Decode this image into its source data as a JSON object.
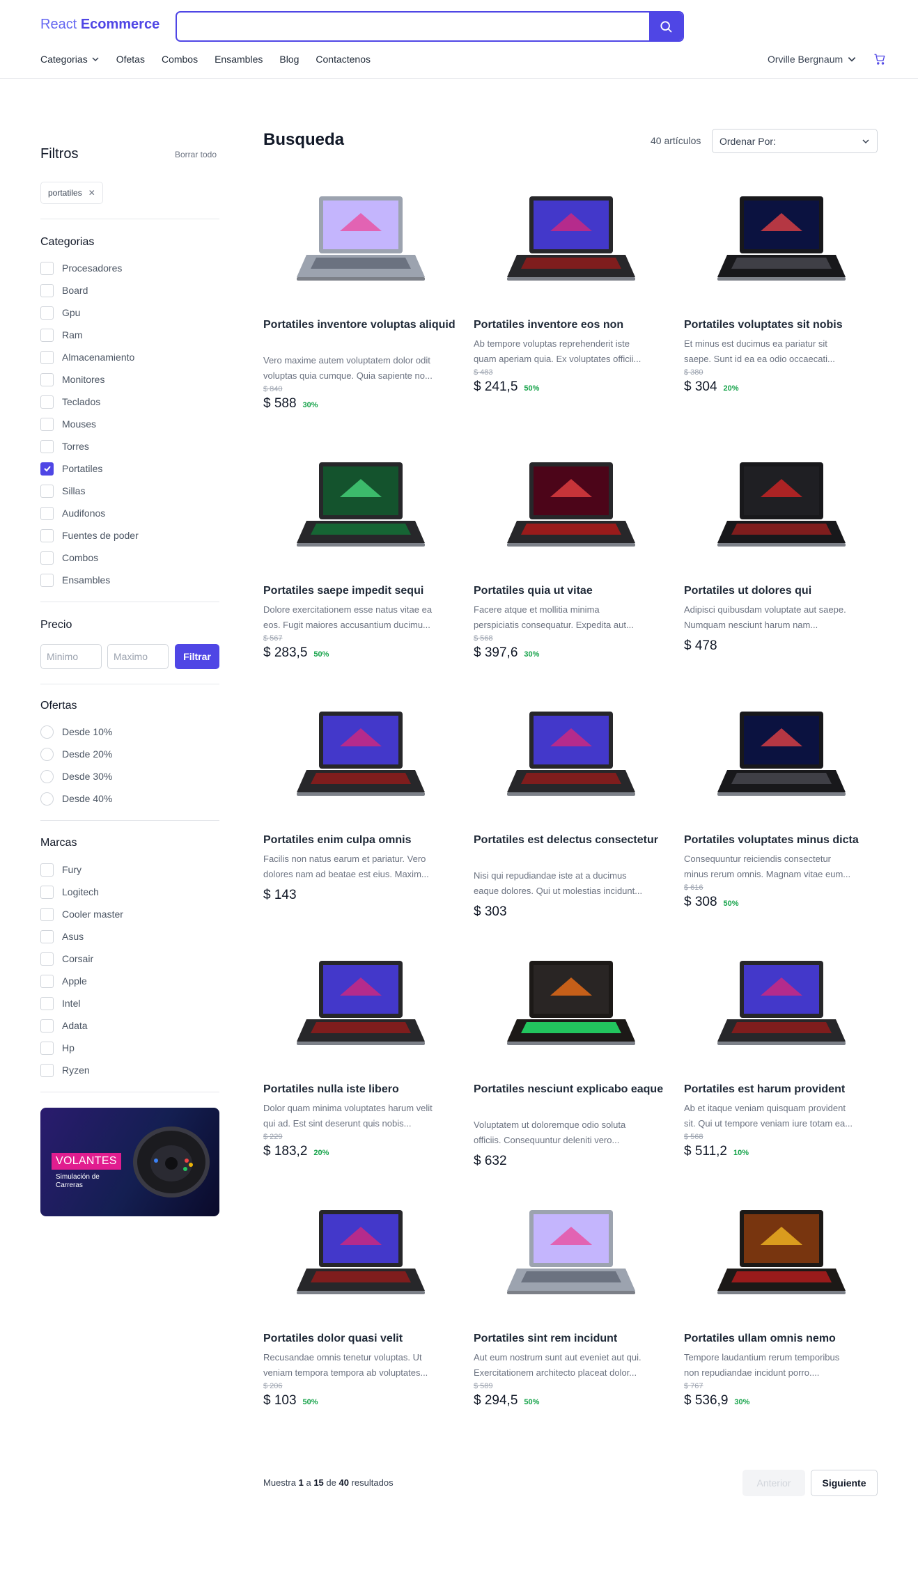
{
  "header": {
    "logo_first": "React",
    "logo_second": "Ecommerce",
    "search_value": "",
    "nav": [
      "Categorias",
      "Ofetas",
      "Combos",
      "Ensambles",
      "Blog",
      "Contactenos"
    ],
    "user_name": "Orville Bergnaum"
  },
  "filters": {
    "title": "Filtros",
    "clear_all": "Borrar todo",
    "active_chip": "portatiles",
    "categories_title": "Categorias",
    "categories": [
      {
        "label": "Procesadores",
        "checked": false
      },
      {
        "label": "Board",
        "checked": false
      },
      {
        "label": "Gpu",
        "checked": false
      },
      {
        "label": "Ram",
        "checked": false
      },
      {
        "label": "Almacenamiento",
        "checked": false
      },
      {
        "label": "Monitores",
        "checked": false
      },
      {
        "label": "Teclados",
        "checked": false
      },
      {
        "label": "Mouses",
        "checked": false
      },
      {
        "label": "Torres",
        "checked": false
      },
      {
        "label": "Portatiles",
        "checked": true
      },
      {
        "label": "Sillas",
        "checked": false
      },
      {
        "label": "Audifonos",
        "checked": false
      },
      {
        "label": "Fuentes de poder",
        "checked": false
      },
      {
        "label": "Combos",
        "checked": false
      },
      {
        "label": "Ensambles",
        "checked": false
      }
    ],
    "price_title": "Precio",
    "price_min_placeholder": "Minimo",
    "price_max_placeholder": "Maximo",
    "filter_button": "Filtrar",
    "offers_title": "Ofertas",
    "offers": [
      "Desde 10%",
      "Desde 20%",
      "Desde 30%",
      "Desde 40%"
    ],
    "brands_title": "Marcas",
    "brands": [
      "Fury",
      "Logitech",
      "Cooler master",
      "Asus",
      "Corsair",
      "Apple",
      "Intel",
      "Adata",
      "Hp",
      "Ryzen"
    ],
    "banner_tag": "VOLANTES",
    "banner_sub": "Simulación de Carreras"
  },
  "main": {
    "title": "Busqueda",
    "count": "40 artículos",
    "sort_label": "Ordenar Por:"
  },
  "products": [
    {
      "name": "Portatiles inventore voluptas aliquid",
      "desc": [
        "Vero maxime autem voluptatem dolor odit",
        "voluptas quia cumque. Quia sapiente no..."
      ],
      "old": "$ 840",
      "price": "$ 588",
      "disc": "30%",
      "image": "laptop-silver-icon"
    },
    {
      "name": "Portatiles inventore eos non",
      "desc": [
        "Ab tempore voluptas reprehenderit iste",
        "quam aperiam quia. Ex voluptates officii..."
      ],
      "old": "$ 483",
      "price": "$ 241,5",
      "disc": "50%",
      "image": "laptop-rog-icon"
    },
    {
      "name": "Portatiles voluptates sit nobis",
      "desc": [
        "Et minus est ducimus ea pariatur sit",
        "saepe. Sunt id ea ea odio occaecati..."
      ],
      "old": "$ 380",
      "price": "$ 304",
      "disc": "20%",
      "image": "laptop-xpg-icon"
    },
    {
      "name": "Portatiles saepe impedit sequi",
      "desc": [
        "Dolore exercitationem esse natus vitae ea",
        "eos. Fugit maiores accusantium ducimu..."
      ],
      "old": "$ 567",
      "price": "$ 283,5",
      "disc": "50%",
      "image": "laptop-green-icon"
    },
    {
      "name": "Portatiles quia ut vitae",
      "desc": [
        "Facere atque et mollitia minima",
        "perspiciatis consequatur. Expedita aut..."
      ],
      "old": "$ 568",
      "price": "$ 397,6",
      "disc": "30%",
      "image": "laptop-rog-strix-icon"
    },
    {
      "name": "Portatiles ut dolores qui",
      "desc": [
        "Adipisci quibusdam voluptate aut saepe.",
        "Numquam nesciunt harum nam..."
      ],
      "old": "",
      "price": "$ 478",
      "disc": "",
      "image": "laptop-msi-icon"
    },
    {
      "name": "Portatiles enim culpa omnis",
      "desc": [
        "Facilis non natus earum et pariatur. Vero",
        "dolores nam ad beatae est eius. Maxim..."
      ],
      "old": "",
      "price": "$ 143",
      "disc": "",
      "image": "laptop-rog-icon"
    },
    {
      "name": "Portatiles est delectus consectetur",
      "desc": [
        "Nisi qui repudiandae iste at a ducimus",
        "eaque dolores. Qui ut molestias incidunt..."
      ],
      "old": "",
      "price": "$ 303",
      "disc": "",
      "image": "laptop-rog-icon"
    },
    {
      "name": "Portatiles voluptates minus dicta",
      "desc": [
        "Consequuntur reiciendis consectetur",
        "minus rerum omnis. Magnam vitae eum..."
      ],
      "old": "$ 616",
      "price": "$ 308",
      "disc": "50%",
      "image": "laptop-xpg-icon"
    },
    {
      "name": "Portatiles nulla iste libero",
      "desc": [
        "Dolor quam minima voluptates harum velit",
        "qui ad. Est sint deserunt quis nobis..."
      ],
      "old": "$ 229",
      "price": "$ 183,2",
      "disc": "20%",
      "image": "laptop-rog-icon"
    },
    {
      "name": "Portatiles nesciunt explicabo eaque",
      "desc": [
        "Voluptatem ut doloremque odio soluta",
        "officiis. Consequuntur deleniti vero..."
      ],
      "old": "",
      "price": "$ 632",
      "disc": "",
      "image": "laptop-rog-scar-icon"
    },
    {
      "name": "Portatiles est harum provident",
      "desc": [
        "Ab et itaque veniam quisquam provident",
        "sit. Qui ut tempore veniam iure totam ea..."
      ],
      "old": "$ 568",
      "price": "$ 511,2",
      "disc": "10%",
      "image": "laptop-rog-icon"
    },
    {
      "name": "Portatiles dolor quasi velit",
      "desc": [
        "Recusandae omnis tenetur voluptas. Ut",
        "veniam tempora tempora ab voluptates..."
      ],
      "old": "$ 206",
      "price": "$ 103",
      "disc": "50%",
      "image": "laptop-rog-icon"
    },
    {
      "name": "Portatiles sint rem incidunt",
      "desc": [
        "Aut eum nostrum sunt aut eveniet aut qui.",
        "Exercitationem architecto placeat dolor..."
      ],
      "old": "$ 589",
      "price": "$ 294,5",
      "disc": "50%",
      "image": "laptop-silver-icon"
    },
    {
      "name": "Portatiles ullam omnis nemo",
      "desc": [
        "Tempore laudantium rerum temporibus",
        "non repudiandae incidunt porro...."
      ],
      "old": "$ 767",
      "price": "$ 536,9",
      "disc": "30%",
      "image": "laptop-tuf-icon"
    }
  ],
  "pagination": {
    "text_prefix": "Muestra",
    "from": "1",
    "text_a": "a",
    "to": "15",
    "text_de": "de",
    "total": "40",
    "text_suffix": "resultados",
    "prev": "Anterior",
    "next": "Siguiente"
  }
}
